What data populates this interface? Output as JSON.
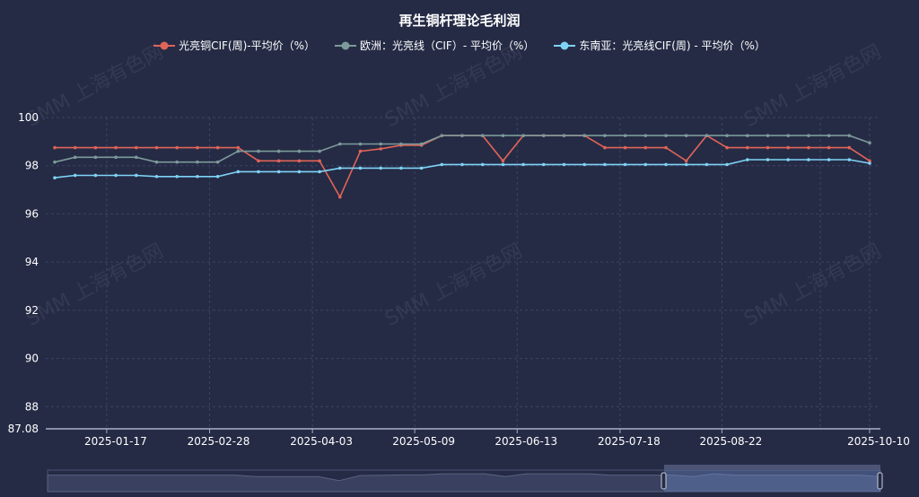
{
  "chart_data": {
    "type": "line",
    "title": "再生铜杆理论毛利润",
    "ylim": [
      87.08,
      100
    ],
    "y_ticks": [
      "100",
      "98",
      "96",
      "94",
      "92",
      "90",
      "88",
      "87.08"
    ],
    "x_tick_labels": [
      "2025-01-17",
      "2025-02-28",
      "2025-04-03",
      "2025-05-09",
      "2025-06-13",
      "2025-07-18",
      "2025-08-22",
      "2025-10-10"
    ],
    "legend_position": "top-center",
    "grid": true,
    "series": [
      {
        "name": "光亮铜CIF(周)-平均价（%）",
        "color": "#e06458",
        "values": [
          98.75,
          98.75,
          98.75,
          98.75,
          98.75,
          98.75,
          98.75,
          98.75,
          98.75,
          98.75,
          98.2,
          98.2,
          98.2,
          98.2,
          96.7,
          98.6,
          98.7,
          98.85,
          98.85,
          99.25,
          99.25,
          99.25,
          98.2,
          99.25,
          99.25,
          99.25,
          99.25,
          98.75,
          98.75,
          98.75,
          98.75,
          98.2,
          99.25,
          98.75,
          98.75,
          98.75,
          98.75,
          98.75,
          98.75,
          98.75,
          98.2
        ]
      },
      {
        "name": "欧洲：光亮线（CIF）- 平均价（%）",
        "color": "#7d9a9a",
        "values": [
          98.15,
          98.35,
          98.35,
          98.35,
          98.35,
          98.15,
          98.15,
          98.15,
          98.15,
          98.6,
          98.6,
          98.6,
          98.6,
          98.6,
          98.9,
          98.9,
          98.9,
          98.9,
          98.9,
          99.25,
          99.25,
          99.25,
          99.25,
          99.25,
          99.25,
          99.25,
          99.25,
          99.25,
          99.25,
          99.25,
          99.25,
          99.25,
          99.25,
          99.25,
          99.25,
          99.25,
          99.25,
          99.25,
          99.25,
          99.25,
          98.95
        ]
      },
      {
        "name": "东南亚：光亮线CIF(周) - 平均价（%）",
        "color": "#7fd3f5",
        "values": [
          97.5,
          97.6,
          97.6,
          97.6,
          97.6,
          97.55,
          97.55,
          97.55,
          97.55,
          97.75,
          97.75,
          97.75,
          97.75,
          97.75,
          97.9,
          97.9,
          97.9,
          97.9,
          97.9,
          98.05,
          98.05,
          98.05,
          98.05,
          98.05,
          98.05,
          98.05,
          98.05,
          98.05,
          98.05,
          98.05,
          98.05,
          98.05,
          98.05,
          98.05,
          98.25,
          98.25,
          98.25,
          98.25,
          98.25,
          98.25,
          98.1
        ]
      }
    ]
  },
  "watermark": "SMM 上海有色网"
}
